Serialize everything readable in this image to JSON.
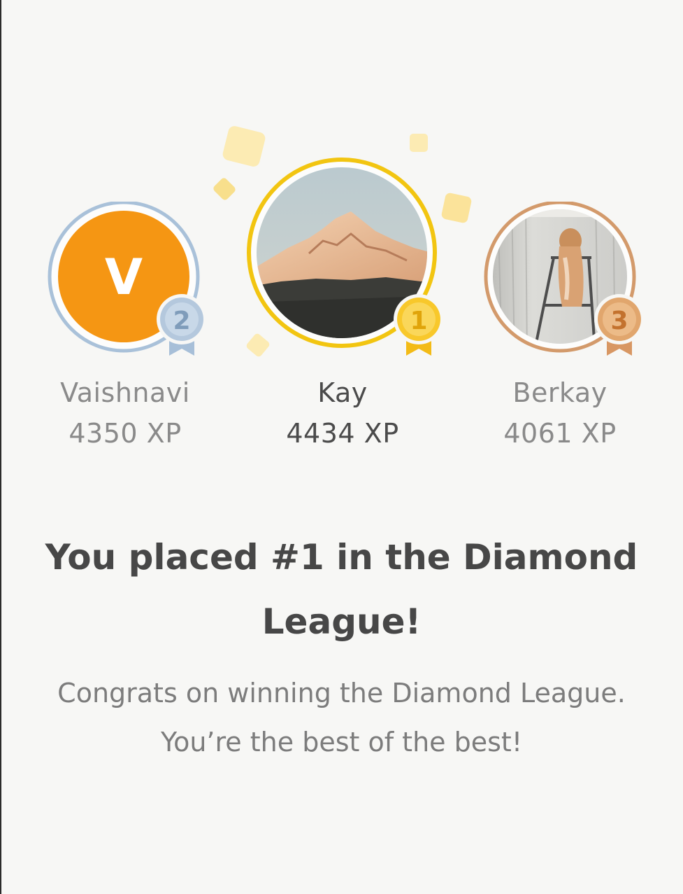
{
  "podium": {
    "first": {
      "name": "Kay",
      "xp": "4434 XP",
      "rank": "1",
      "avatar": "mountain-photo",
      "ring_color": "#f2c511",
      "medal_color": "#f8c82b"
    },
    "second": {
      "name": "Vaishnavi",
      "xp": "4350 XP",
      "rank": "2",
      "avatar_initial": "V",
      "avatar_bg": "#f59613",
      "ring_color": "#a9c1d9",
      "medal_color": "#b4c8dd"
    },
    "third": {
      "name": "Berkay",
      "xp": "4061 XP",
      "rank": "3",
      "avatar": "cat-on-ladder-photo",
      "ring_color": "#d39a6b",
      "medal_color": "#e1a66d"
    }
  },
  "result": {
    "headline": "You placed #1 in the Diamond League!",
    "subtext": "Congrats on winning the Diamond League. You’re the best of the best!"
  },
  "colors": {
    "background": "#f7f7f5",
    "confetti": "#fbe7a8",
    "headline": "#474747",
    "body_text": "#7c7c7c"
  }
}
